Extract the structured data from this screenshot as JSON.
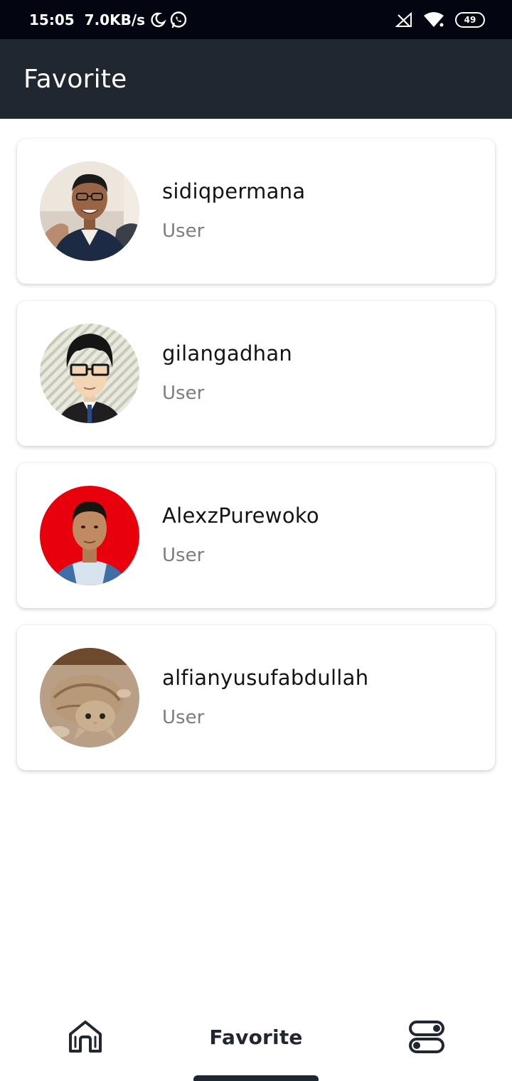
{
  "status_bar": {
    "time": "15:05",
    "net_speed": "7.0KB/s",
    "battery": "49",
    "icons": [
      "moon-icon",
      "whatsapp-icon",
      "signal-icon",
      "wifi-icon",
      "battery-icon"
    ]
  },
  "app_bar": {
    "title": "Favorite"
  },
  "favorites": [
    {
      "username": "sidiqpermana",
      "role": "User"
    },
    {
      "username": "gilangadhan",
      "role": "User"
    },
    {
      "username": "AlexzPurewoko",
      "role": "User"
    },
    {
      "username": "alfianyusufabdullah",
      "role": "User"
    }
  ],
  "bottom_nav": {
    "home_icon": "home-icon",
    "favorite_label": "Favorite",
    "settings_icon": "settings-toggle-icon"
  },
  "colors": {
    "status_bar": "#030510",
    "app_bar": "#212731",
    "role_text": "#7d7d7d"
  }
}
